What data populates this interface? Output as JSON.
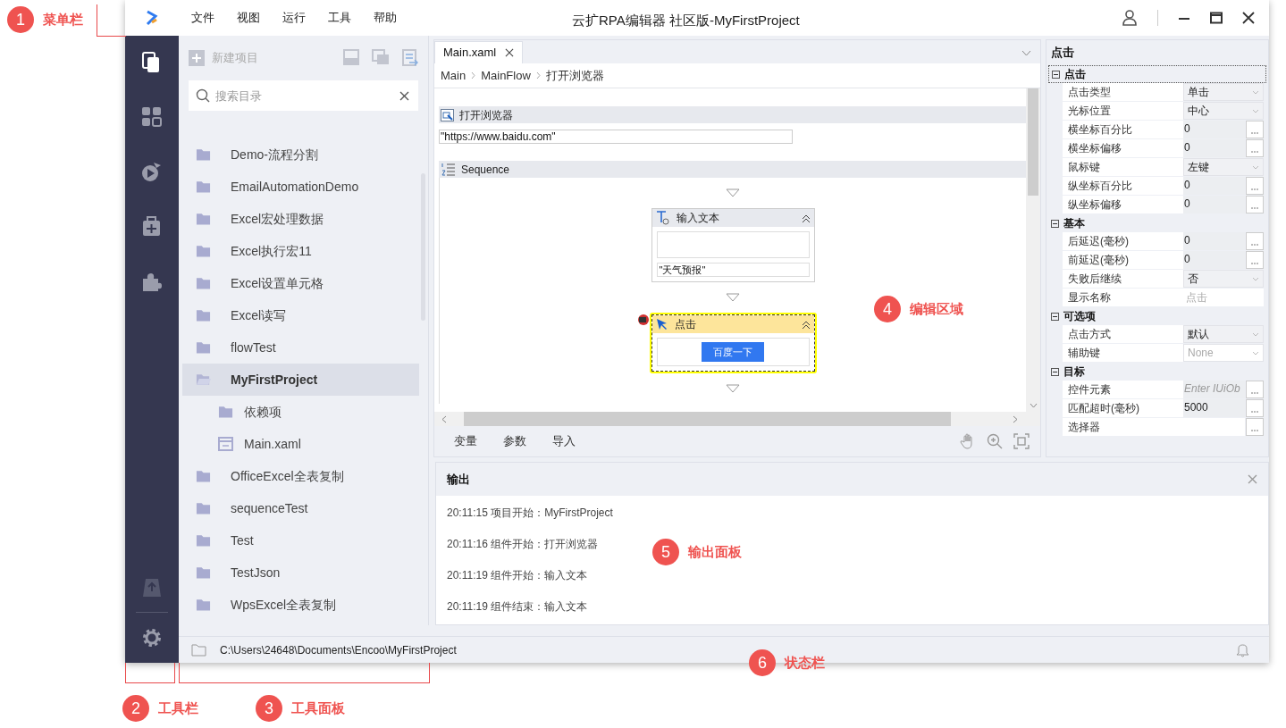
{
  "annotations": [
    {
      "number": "1",
      "label": "菜单栏"
    },
    {
      "number": "2",
      "label": "工具栏"
    },
    {
      "number": "3",
      "label": "工具面板"
    },
    {
      "number": "4",
      "label": "编辑区域"
    },
    {
      "number": "5",
      "label": "输出面板"
    },
    {
      "number": "6",
      "label": "状态栏"
    }
  ],
  "window": {
    "title": "云扩RPA编辑器 社区版-MyFirstProject",
    "menu": [
      "文件",
      "视图",
      "运行",
      "工具",
      "帮助"
    ]
  },
  "activity_bar": [
    {
      "selected": true
    },
    {
      "selected": false
    },
    {
      "selected": false
    },
    {
      "selected": false
    },
    {
      "selected": false
    }
  ],
  "project_panel": {
    "new_project": "新建项目",
    "search_placeholder": "搜索目录",
    "items": [
      {
        "name": "Demo-流程分割",
        "selected": false
      },
      {
        "name": "EmailAutomationDemo",
        "selected": false
      },
      {
        "name": "Excel宏处理数据",
        "selected": false
      },
      {
        "name": "Excel执行宏11",
        "selected": false
      },
      {
        "name": "Excel设置单元格",
        "selected": false
      },
      {
        "name": "Excel读写",
        "selected": false
      },
      {
        "name": "flowTest",
        "selected": false
      },
      {
        "name": "MyFirstProject",
        "selected": true,
        "children": [
          {
            "name": "依赖项",
            "kind": "folder"
          },
          {
            "name": "Main.xaml",
            "kind": "file"
          }
        ]
      },
      {
        "name": "OfficeExcel全表复制",
        "selected": false
      },
      {
        "name": "sequenceTest",
        "selected": false
      },
      {
        "name": "Test",
        "selected": false
      },
      {
        "name": "TestJson",
        "selected": false
      },
      {
        "name": "WpsExcel全表复制",
        "selected": false
      }
    ]
  },
  "editor": {
    "tabs": [
      {
        "label": "Main.xaml",
        "selected": true
      }
    ],
    "breadcrumb": [
      "Main",
      "MainFlow",
      "打开浏览器"
    ],
    "open_browser": {
      "title": "打开浏览器",
      "url": "\"https://www.baidu.com\""
    },
    "sequence": {
      "title": "Sequence",
      "activities": [
        {
          "kind": "type_text",
          "title": "输入文本",
          "text": "\"天气预报\"",
          "selected": false
        },
        {
          "kind": "click",
          "title": "点击",
          "button": "百度一下",
          "selected": true
        }
      ]
    },
    "bottom_tabs": [
      "变量",
      "参数",
      "导入"
    ]
  },
  "properties": {
    "title": "点击",
    "groups": [
      {
        "name": "点击",
        "selected": true,
        "rows": [
          {
            "label": "点击类型",
            "kind": "dropdown",
            "value": "单击"
          },
          {
            "label": "光标位置",
            "kind": "dropdown",
            "value": "中心"
          },
          {
            "label": "横坐标百分比",
            "kind": "expression",
            "value": "0"
          },
          {
            "label": "横坐标偏移",
            "kind": "expression",
            "value": "0"
          },
          {
            "label": "鼠标键",
            "kind": "dropdown",
            "value": "左键"
          },
          {
            "label": "纵坐标百分比",
            "kind": "expression",
            "value": "0"
          },
          {
            "label": "纵坐标偏移",
            "kind": "expression",
            "value": "0"
          }
        ]
      },
      {
        "name": "基本",
        "selected": false,
        "rows": [
          {
            "label": "后延迟(毫秒)",
            "kind": "expression",
            "value": "0"
          },
          {
            "label": "前延迟(毫秒)",
            "kind": "expression",
            "value": "0"
          },
          {
            "label": "失败后继续",
            "kind": "dropdown",
            "value": "否"
          },
          {
            "label": "显示名称",
            "kind": "text",
            "placeholder": "点击"
          }
        ]
      },
      {
        "name": "可选项",
        "selected": false,
        "rows": [
          {
            "label": "点击方式",
            "kind": "dropdown",
            "value": "默认"
          },
          {
            "label": "辅助键",
            "kind": "dropdown",
            "placeholder": "None"
          }
        ]
      },
      {
        "name": "目标",
        "selected": false,
        "rows": [
          {
            "label": "控件元素",
            "kind": "expression",
            "placeholder": "Enter IUiOb"
          },
          {
            "label": "匹配超时(毫秒)",
            "kind": "expression",
            "value": "5000"
          },
          {
            "label": "选择器",
            "kind": "expression"
          }
        ]
      }
    ]
  },
  "output": {
    "title": "输出",
    "lines": [
      "20:11:15 项目开始：MyFirstProject",
      "20:11:16 组件开始：打开浏览器",
      "20:11:19 组件开始：输入文本",
      "20:11:19 组件结束：输入文本"
    ]
  },
  "status_bar": {
    "path": "C:\\Users\\24648\\Documents\\Encoo\\MyFirstProject"
  }
}
